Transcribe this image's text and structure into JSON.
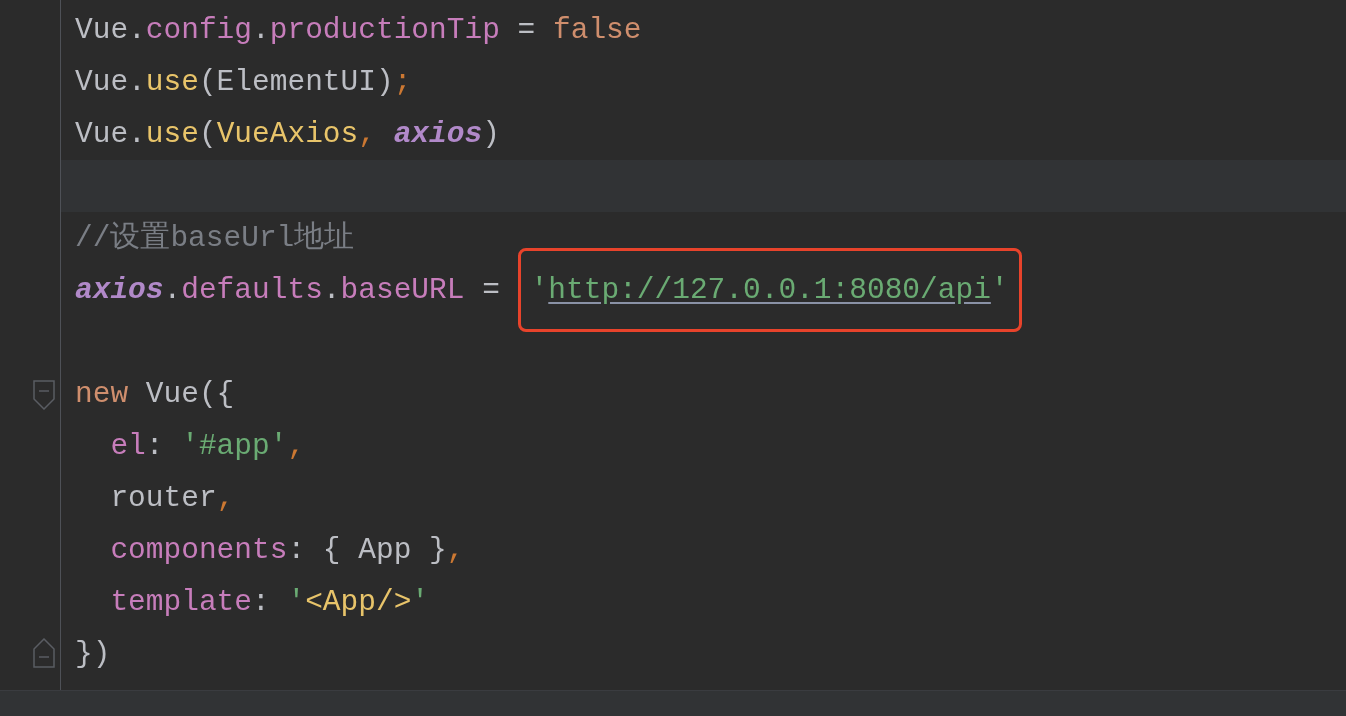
{
  "editor": {
    "lines": [
      {
        "kind": "code",
        "tokens": [
          {
            "text": "Vue",
            "kind": "plain"
          },
          {
            "text": ".",
            "kind": "plain"
          },
          {
            "text": "config",
            "kind": "property"
          },
          {
            "text": ".",
            "kind": "plain"
          },
          {
            "text": "productionTip",
            "kind": "property"
          },
          {
            "text": " = ",
            "kind": "plain"
          },
          {
            "text": "false",
            "kind": "keyword"
          }
        ]
      },
      {
        "kind": "code",
        "tokens": [
          {
            "text": "Vue",
            "kind": "plain"
          },
          {
            "text": ".",
            "kind": "plain"
          },
          {
            "text": "use",
            "kind": "function"
          },
          {
            "text": "(ElementUI)",
            "kind": "plain"
          },
          {
            "text": ";",
            "kind": "punct"
          }
        ]
      },
      {
        "kind": "code",
        "tokens": [
          {
            "text": "Vue",
            "kind": "plain"
          },
          {
            "text": ".",
            "kind": "plain"
          },
          {
            "text": "use",
            "kind": "function"
          },
          {
            "text": "(",
            "kind": "plain"
          },
          {
            "text": "VueAxios",
            "kind": "function"
          },
          {
            "text": ", ",
            "kind": "punct"
          },
          {
            "text": "axios",
            "kind": "global"
          },
          {
            "text": ")",
            "kind": "plain"
          }
        ]
      },
      {
        "kind": "blank",
        "current": true
      },
      {
        "kind": "code",
        "tokens": [
          {
            "text": "//设置baseUrl地址",
            "kind": "comment"
          }
        ]
      },
      {
        "kind": "code",
        "tokens": [
          {
            "text": "axios",
            "kind": "global"
          },
          {
            "text": ".",
            "kind": "plain"
          },
          {
            "text": "defaults",
            "kind": "property"
          },
          {
            "text": ".",
            "kind": "plain"
          },
          {
            "text": "baseURL",
            "kind": "property"
          },
          {
            "text": " = ",
            "kind": "plain"
          },
          {
            "kind": "callout",
            "tokens": [
              {
                "text": "'",
                "kind": "quote"
              },
              {
                "text": "http://127.0.0.1:8080/api",
                "kind": "link"
              },
              {
                "text": "'",
                "kind": "quote"
              }
            ]
          }
        ]
      },
      {
        "kind": "blank"
      },
      {
        "kind": "code",
        "fold_start": true,
        "tokens": [
          {
            "text": "new",
            "kind": "keyword"
          },
          {
            "text": " Vue({",
            "kind": "plain"
          }
        ]
      },
      {
        "kind": "code",
        "tokens": [
          {
            "text": "  el",
            "kind": "property"
          },
          {
            "text": ": ",
            "kind": "plain"
          },
          {
            "text": "'#app'",
            "kind": "string"
          },
          {
            "text": ",",
            "kind": "punct"
          }
        ]
      },
      {
        "kind": "code",
        "tokens": [
          {
            "text": "  router",
            "kind": "plain"
          },
          {
            "text": ",",
            "kind": "punct"
          }
        ]
      },
      {
        "kind": "code",
        "tokens": [
          {
            "text": "  components",
            "kind": "property"
          },
          {
            "text": ": { App }",
            "kind": "plain"
          },
          {
            "text": ",",
            "kind": "punct"
          }
        ]
      },
      {
        "kind": "code",
        "tokens": [
          {
            "text": "  template",
            "kind": "property"
          },
          {
            "text": ": ",
            "kind": "plain"
          },
          {
            "text": "'",
            "kind": "quote"
          },
          {
            "text": "<App/>",
            "kind": "function"
          },
          {
            "text": "'",
            "kind": "quote"
          }
        ]
      },
      {
        "kind": "code",
        "fold_end": true,
        "tokens": [
          {
            "text": "})",
            "kind": "plain"
          }
        ]
      }
    ]
  }
}
